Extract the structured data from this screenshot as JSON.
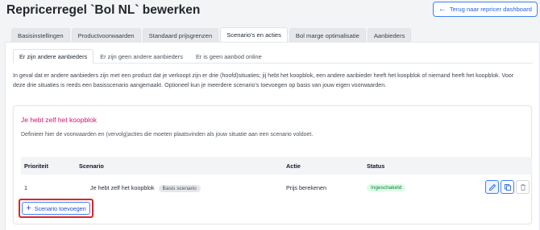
{
  "header": {
    "title": "Repricerregel `Bol NL` bewerken",
    "back_label": "Terug naar repricer dashboard"
  },
  "tabs": [
    {
      "label": "Basisinstellingen",
      "active": false
    },
    {
      "label": "Productvoorwaarden",
      "active": false
    },
    {
      "label": "Standaard prijsgrenzen",
      "active": false
    },
    {
      "label": "Scenario's en acties",
      "active": true
    },
    {
      "label": "Bol marge optimalisatie",
      "active": false
    },
    {
      "label": "Aanbieders",
      "active": false
    }
  ],
  "subtabs": [
    {
      "label": "Er zijn andere aanbieders",
      "active": true
    },
    {
      "label": "Er zijn geen andere aanbieders",
      "active": false
    },
    {
      "label": "Er is geen aanbod online",
      "active": false
    }
  ],
  "intro": {
    "line1": "In geval dat er andere aanbieders zijn met een product dat je verkoopt zijn er drie (hoofd)situaties; jij hebt het koopblok, een andere aanbieder heeft het koopblok of niemand heeft het koopblok. Voor",
    "line2": "deze drie situaties is reeds een basisscenario aangemaakt. Optioneel kun je meerdere scenario's toevoegen op basis van jouw eigen voorwaarden."
  },
  "card": {
    "title": "Je hebt zelf het koopblok",
    "description": "Definieer hier de voorwaarden en (vervolg)acties die moeten plaatsvinden als jouw situatie aan een scenario voldoet.",
    "columns": {
      "priority": "Prioriteit",
      "scenario": "Scenario",
      "action": "Actie",
      "status": "Status"
    },
    "rows": [
      {
        "priority": "1",
        "scenario": "Je hebt zelf het koopblok",
        "badge": "Basis scenario",
        "action": "Prijs berekenen",
        "status": "Ingeschakeld"
      }
    ],
    "add_button": "Scenario toevoegen"
  },
  "colors": {
    "accent": "#3b82f6",
    "card_title": "#d8126b",
    "highlight": "#e02424",
    "status_green": "#15803d"
  }
}
